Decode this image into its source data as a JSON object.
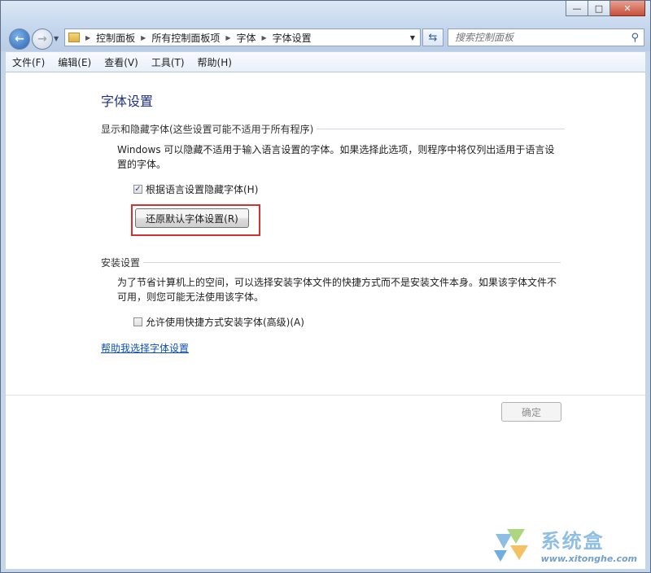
{
  "window": {
    "caption_buttons": [
      "—",
      "□",
      "✕"
    ]
  },
  "address_bar": {
    "crumbs": [
      "控制面板",
      "所有控制面板项",
      "字体",
      "字体设置"
    ],
    "search_placeholder": "搜索控制面板"
  },
  "menu": {
    "items": [
      "文件(F)",
      "编辑(E)",
      "查看(V)",
      "工具(T)",
      "帮助(H)"
    ]
  },
  "main": {
    "title": "字体设置",
    "section_show_hide": {
      "heading": "显示和隐藏字体(这些设置可能不适用于所有程序)",
      "description_line1": "Windows 可以隐藏不适用于输入语言设置的字体。如果选择此选项，则程序中将仅列出适用于语言设",
      "description_line2": "置的字体。",
      "checkbox_label": "根据语言设置隐藏字体(H)",
      "checkbox_checked": true,
      "restore_button_label": "还原默认字体设置(R)"
    },
    "section_install": {
      "heading": "安装设置",
      "description_line1": "为了节省计算机上的空间，可以选择安装字体文件的快捷方式而不是安装文件本身。如果该字体文件不",
      "description_line2": "可用，则您可能无法使用该字体。",
      "checkbox_label": "允许使用快捷方式安装字体(高级)(A)",
      "checkbox_checked": false
    },
    "help_link": "帮助我选择字体设置",
    "ok_button_label": "确定"
  },
  "watermark": {
    "name": "系统盒",
    "url": "www.xitonghe.com"
  },
  "colors": {
    "highlight_box": "#d23232",
    "title": "#1e3287",
    "link": "#0d4fb8"
  }
}
